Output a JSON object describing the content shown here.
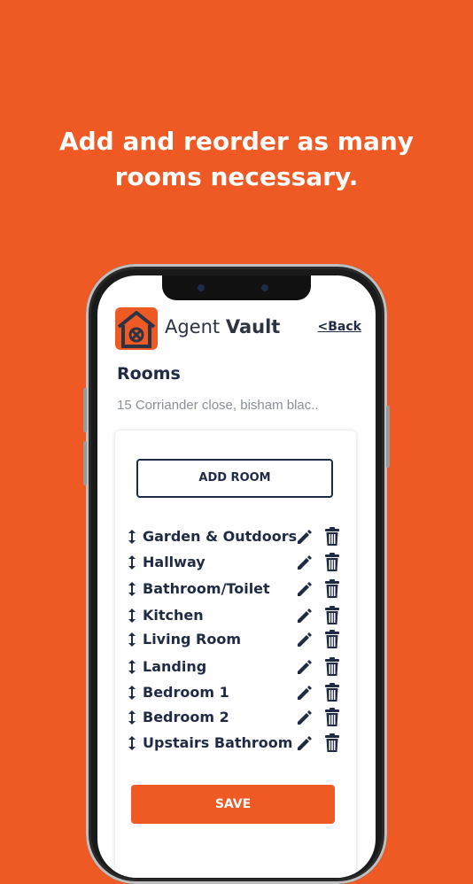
{
  "headline": {
    "line1": "Add and reorder as many",
    "line2": "rooms necessary."
  },
  "app": {
    "brand_regular": "Agent ",
    "brand_bold": "Vault",
    "back_label": "<Back",
    "logo_icon": "house-safe-icon"
  },
  "page": {
    "title": "Rooms",
    "address": "15 Corriander close, bisham blac.."
  },
  "actions": {
    "add_room_label": "ADD ROOM",
    "save_label": "SAVE"
  },
  "rooms": [
    {
      "label": "Garden & Outdoors"
    },
    {
      "label": "Hallway"
    },
    {
      "label": "Bathroom/Toilet"
    },
    {
      "label": "Kitchen"
    },
    {
      "label": "Living Room"
    },
    {
      "label": "Landing"
    },
    {
      "label": "Bedroom 1"
    },
    {
      "label": "Bedroom 2"
    },
    {
      "label": "Upstairs Bathroom"
    }
  ],
  "colors": {
    "brand_orange": "#ef5a24",
    "navy": "#1f2a44"
  }
}
